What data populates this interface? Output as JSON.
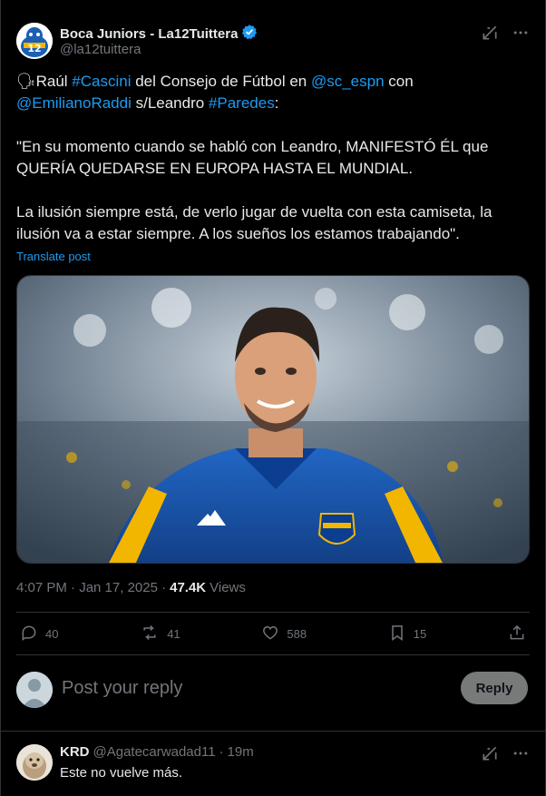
{
  "post": {
    "display_name": "Boca Juniors - La12Tuittera",
    "handle": "@la12tuittera",
    "text": {
      "line1": {
        "emoji": "🗣",
        "prefix": "Raúl ",
        "hashtag1": "#Cascini",
        "mid": " del Consejo de Fútbol en ",
        "mention1": "@sc_espn",
        "post": " con"
      },
      "line2": {
        "mention2": "@EmilianoRaddi",
        "mid": " s/Leandro ",
        "hashtag2": "#Paredes",
        "post": ":"
      },
      "para2": "\"En su momento cuando se habló con Leandro, MANIFESTÓ ÉL que QUERÍA QUEDARSE EN EUROPA HASTA EL MUNDIAL.",
      "para3": "La ilusión siempre está, de verlo jugar de vuelta con esta camiseta, la ilusión va a estar siempre. A los sueños los estamos trabajando\"."
    },
    "translate_label": "Translate post",
    "timestamp": "4:07 PM · Jan 17, 2025 ·",
    "views_count": "47.4K",
    "views_label": "Views"
  },
  "actions": {
    "replies": "40",
    "reposts": "41",
    "likes": "588",
    "bookmarks": "15"
  },
  "reply_box": {
    "placeholder": "Post your reply",
    "button_label": "Reply"
  },
  "comment": {
    "name": "KRD",
    "handle": "@Agatecarwadad11",
    "separator": "·",
    "time": "19m",
    "text": "Este no vuelve más."
  },
  "colors": {
    "accent": "#1d9bf0",
    "boca_blue": "#0b3d91",
    "boca_gold": "#f2b600"
  }
}
